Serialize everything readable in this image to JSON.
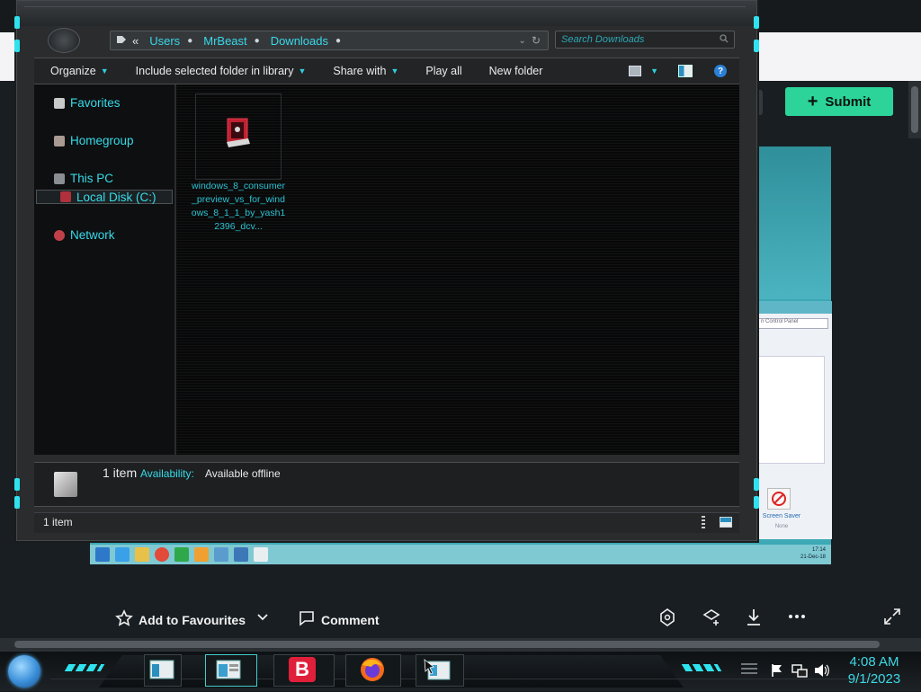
{
  "browser": {
    "submit_label": "Submit"
  },
  "post_actions": {
    "add_to_favourites": "Add to Favourites",
    "comment": "Comment"
  },
  "explorer": {
    "breadcrumb": [
      "Users",
      "MrBeast",
      "Downloads"
    ],
    "breadcrumb_prefix": "«",
    "search_placeholder": "Search Downloads",
    "toolbar": {
      "organize": "Organize",
      "include_in_library": "Include selected folder in library",
      "share_with": "Share with",
      "play_all": "Play all",
      "new_folder": "New folder",
      "help": "?"
    },
    "nav": {
      "favorites": "Favorites",
      "homegroup": "Homegroup",
      "this_pc": "This PC",
      "local_disk": "Local Disk (C:)",
      "network": "Network"
    },
    "file": {
      "name": "windows_8_consumer_preview_vs_for_windows_8_1_1_by_yash12396_dcv..."
    },
    "details": {
      "count": "1 item",
      "availability_label": "Availability:",
      "availability_value": "Available offline"
    },
    "status": {
      "count": "1 item"
    }
  },
  "bg_screenshot": {
    "search_text": "n Control Panel",
    "screen_saver_label": "Screen Saver",
    "screen_saver_value": "None",
    "time": "17:14",
    "date": "21-Dec-18"
  },
  "taskbar": {
    "time": "4:08 AM",
    "date": "9/1/2023",
    "brave_letter": "B"
  },
  "colors": {
    "accent_cyan": "#35dbe9",
    "submit_green": "#2cd49a",
    "window_bg": "#2a2c2e"
  }
}
